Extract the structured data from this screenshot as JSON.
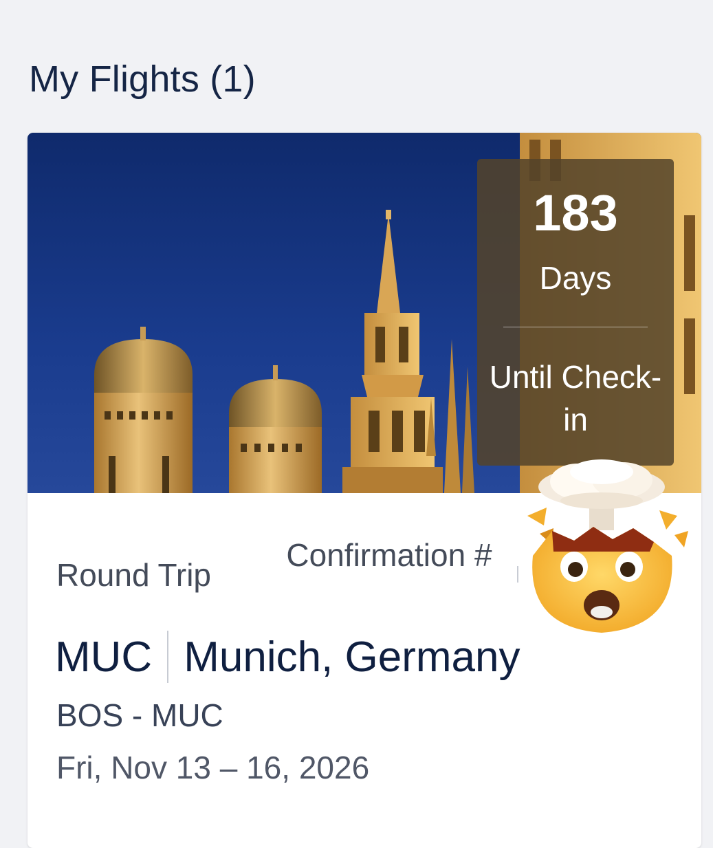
{
  "header": {
    "title": "My Flights (1)"
  },
  "countdown": {
    "number": "183",
    "unit": "Days",
    "label": "Until Check-in"
  },
  "trip": {
    "type": "Round Trip",
    "confirmation_label": "Confirmation #",
    "code": "MUC",
    "city": "Munich, Germany",
    "route": "BOS - MUC",
    "dates": "Fri, Nov 13 – 16, 2026"
  },
  "icons": {
    "hero": "munich-skyline-image",
    "overlay": "exploding-head-emoji-icon"
  },
  "colors": {
    "title": "#152545",
    "sky": "#17357f",
    "badge": "#54442a",
    "background": "#f1f2f5"
  }
}
